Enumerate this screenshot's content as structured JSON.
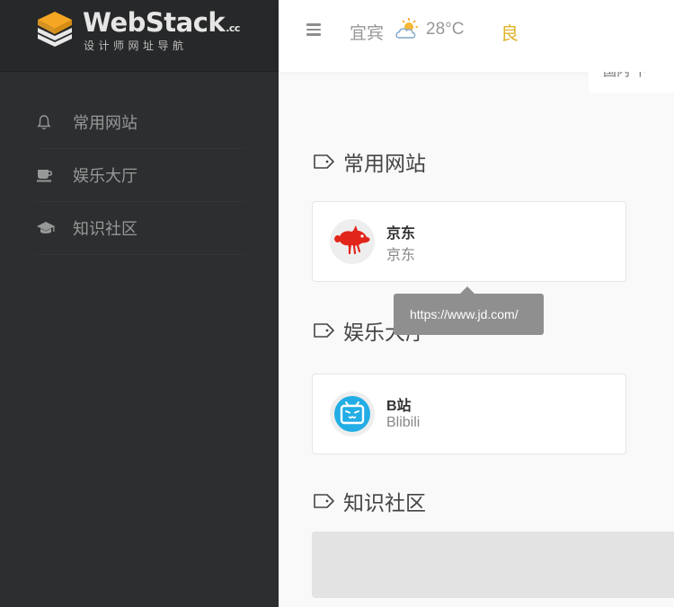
{
  "brand": {
    "title": "WebStack",
    "title_suffix": ".cc",
    "subtitle": "设计师网址导航"
  },
  "sidebar": {
    "items": [
      {
        "label": "常用网站",
        "icon": "bell-icon"
      },
      {
        "label": "娱乐大厅",
        "icon": "coffee-cup-icon"
      },
      {
        "label": "知识社区",
        "icon": "graduation-cap-icon"
      }
    ]
  },
  "header": {
    "city": "宜宾",
    "weather_icon": "partly-cloudy-icon",
    "temperature": "28°C",
    "air_quality": "良",
    "air_quality_color": "#e0b32a",
    "strip_text": "国内 下"
  },
  "sections": [
    {
      "title": "常用网站",
      "cards": [
        {
          "name": "京东",
          "desc": "京东",
          "logo": "jd-dog-logo"
        }
      ]
    },
    {
      "title": "娱乐大厅",
      "cards": [
        {
          "name": "B站",
          "desc": "Blibili",
          "logo": "bilibili-tv-logo"
        }
      ]
    },
    {
      "title": "知识社区",
      "cards": []
    }
  ],
  "tooltip": {
    "text": "https://www.jd.com/"
  },
  "colors": {
    "sidebar_bg": "#2c2e2f",
    "logo_orange": "#f5a623",
    "jd_red": "#e1251b",
    "bilibili_blue": "#23ade5"
  }
}
